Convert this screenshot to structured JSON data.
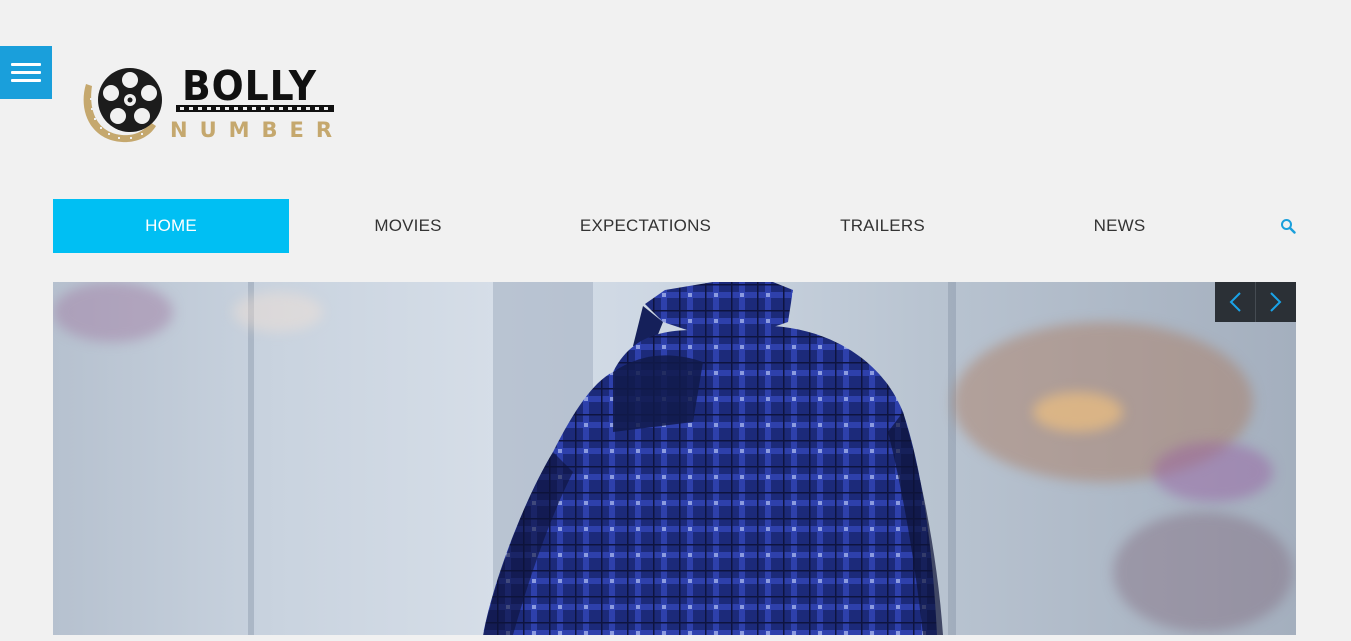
{
  "site": {
    "logo_top": "BOLLY",
    "logo_bottom": "NUMBER"
  },
  "nav": {
    "items": [
      {
        "label": "HOME",
        "active": true
      },
      {
        "label": "MOVIES",
        "active": false
      },
      {
        "label": "EXPECTATIONS",
        "active": false
      },
      {
        "label": "TRAILERS",
        "active": false
      },
      {
        "label": "NEWS",
        "active": false
      }
    ],
    "search_icon": "search-icon"
  },
  "colors": {
    "background": "#f1f1f1",
    "menu_toggle": "#1a9fdb",
    "nav_active": "#00bff3",
    "nav_text": "#333333",
    "logo_gold": "#c5a86e",
    "logo_dark": "#111111",
    "arrow_bg": "#2b3036",
    "arrow_icon": "#1aa3e8"
  },
  "slider": {
    "prev_icon": "chevron-left-icon",
    "next_icon": "chevron-right-icon"
  }
}
